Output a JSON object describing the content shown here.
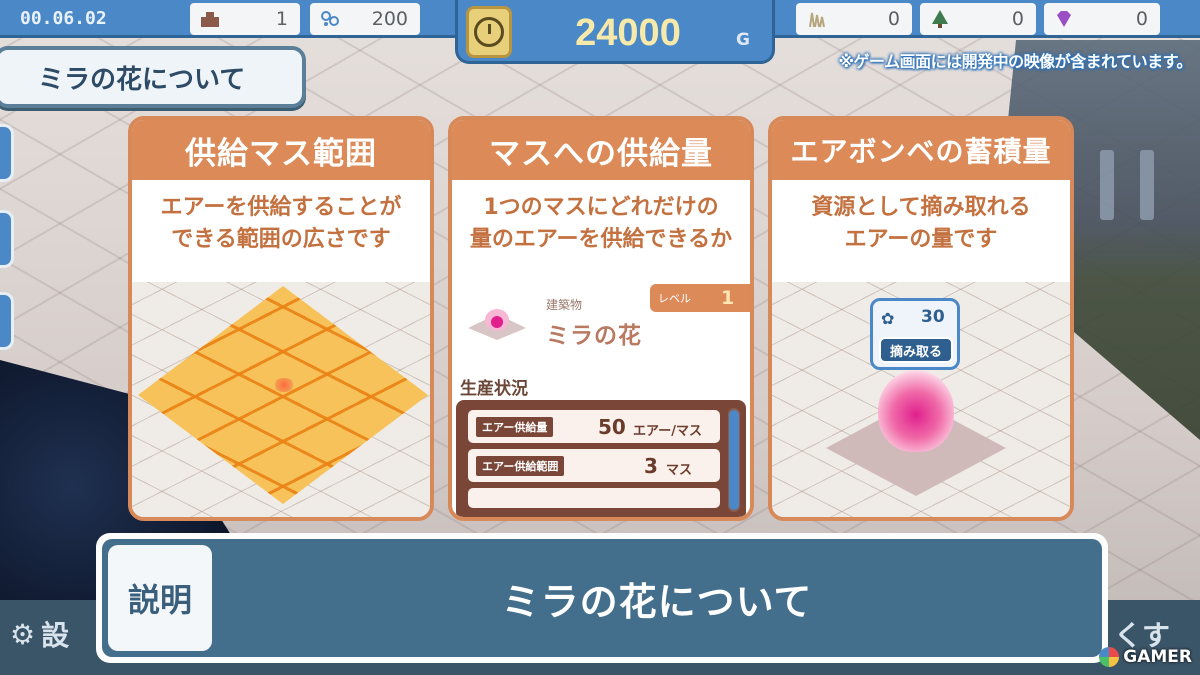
{
  "hud": {
    "time": "00.06.02",
    "resources_left": [
      {
        "icon": "building-icon",
        "value": "1"
      },
      {
        "icon": "air-icon",
        "value": "200"
      }
    ],
    "gold": "24000",
    "gold_unit": "G",
    "resources_right": [
      {
        "icon": "grass-icon",
        "value": "0"
      },
      {
        "icon": "tree-icon",
        "value": "0"
      },
      {
        "icon": "gem-icon",
        "value": "0"
      }
    ],
    "notice": "※ゲーム画面には開発中の映像が含まれています。"
  },
  "title_tab": "ミラの花について",
  "cards": [
    {
      "title": "供給マス範囲",
      "desc_line1": "エアーを供給することが",
      "desc_line2": "できる範囲の広さです"
    },
    {
      "title": "マスへの供給量",
      "desc_line1": "1つのマスにどれだけの",
      "desc_line2": "量のエアーを供給できるか",
      "panel": {
        "level_label": "レベル",
        "level_value": "1",
        "category": "建築物",
        "name": "ミラの花",
        "section": "生産状況",
        "stats": [
          {
            "label": "エアー供給量",
            "value": "50",
            "unit": "エアー/マス"
          },
          {
            "label": "エアー供給範囲",
            "value": "3",
            "unit": "マス"
          }
        ]
      }
    },
    {
      "title": "エアボンベの蓄積量",
      "desc_line1": "資源として摘み取れる",
      "desc_line2": "エアーの量です",
      "bubble": {
        "count": "30",
        "button": "摘み取る"
      }
    }
  ],
  "dialog": {
    "label": "説明",
    "text": "ミラの花について"
  },
  "bottom": {
    "settings": "設",
    "back": "くす"
  },
  "watermark": "GAMER",
  "colors": {
    "hud_blue": "#4a88c7",
    "card_orange": "#db8a58",
    "dialog_blue": "#446f8c",
    "panel_brown": "#7a4637"
  }
}
